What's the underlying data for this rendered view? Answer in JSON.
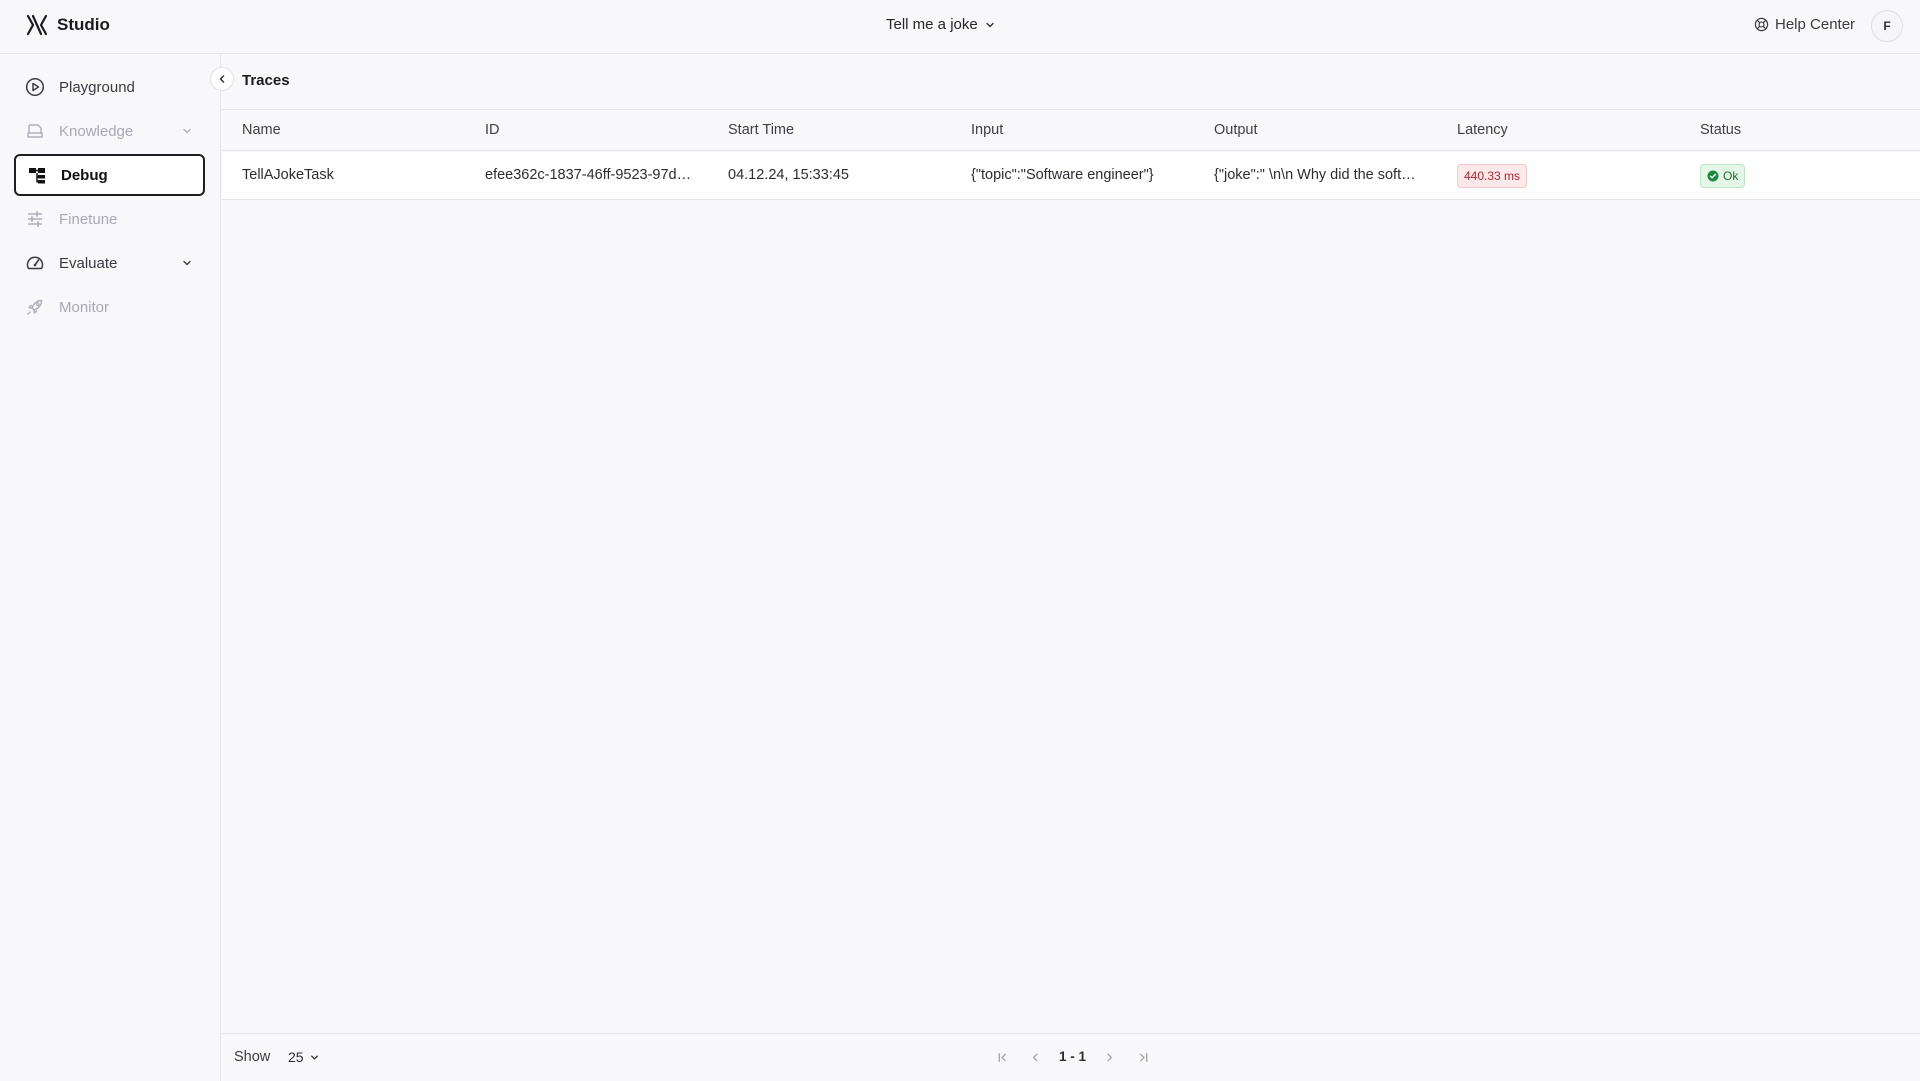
{
  "header": {
    "logo_text": "Studio",
    "project": "Tell me a joke",
    "help_label": "Help Center",
    "avatar_initial": "F"
  },
  "sidebar": {
    "items": [
      {
        "label": "Playground",
        "icon": "play-circle-icon",
        "state": "enabled"
      },
      {
        "label": "Knowledge",
        "icon": "knowledge-icon",
        "state": "disabled",
        "has_chevron": true
      },
      {
        "label": "Debug",
        "icon": "debug-tree-icon",
        "state": "active"
      },
      {
        "label": "Finetune",
        "icon": "sliders-icon",
        "state": "disabled"
      },
      {
        "label": "Evaluate",
        "icon": "gauge-icon",
        "state": "enabled",
        "has_chevron": true
      },
      {
        "label": "Monitor",
        "icon": "rocket-icon",
        "state": "disabled"
      }
    ]
  },
  "main": {
    "title": "Traces",
    "columns": [
      "Name",
      "ID",
      "Start Time",
      "Input",
      "Output",
      "Latency",
      "Status"
    ],
    "rows": [
      {
        "name": "TellAJokeTask",
        "id": "efee362c-1837-46ff-9523-97d…",
        "start_time": "04.12.24, 15:33:45",
        "input": "{\"topic\":\"Software engineer\"}",
        "output": "{\"joke\":\" \\n\\n Why did the soft…",
        "latency": "440.33 ms",
        "status": "Ok"
      }
    ]
  },
  "footer": {
    "show_label": "Show",
    "page_size": "25",
    "range": "1 - 1"
  },
  "colors": {
    "latency_bg": "#fde8ea",
    "latency_text": "#b3262f",
    "status_bg": "#e3f6e8",
    "status_text": "#1c6e34"
  }
}
